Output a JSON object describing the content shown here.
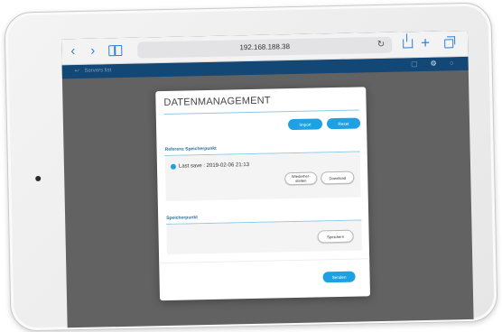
{
  "browser": {
    "url": "192.168.188.38",
    "icons": {
      "back": "back-chevron-icon",
      "forward": "forward-chevron-icon",
      "bookmarks": "book-icon",
      "reload": "reload-icon",
      "share": "share-icon",
      "new_tab": "plus-icon",
      "tabs": "tabs-icon"
    }
  },
  "app_bar": {
    "back_label": "Servers list",
    "icons": [
      "chat-icon",
      "gear-icon",
      "user-icon"
    ]
  },
  "dialog": {
    "title": "DATENMANAGEMENT",
    "import_label": "Import",
    "reset_label": "Reset",
    "ref_section": {
      "heading": "Referenz Speicherpunkt",
      "last_save": "Last save : 2019-02-06 21:13",
      "restore_label": "Wiederher-stellen",
      "download_label": "Download"
    },
    "save_section": {
      "heading": "Speicherpunkt",
      "save_label": "Speichern"
    },
    "send_label": "Senden"
  },
  "colors": {
    "accent": "#1da1e2",
    "app_bar": "#134776",
    "screen_bg": "#626262",
    "section_heading": "#2d6e9e"
  }
}
